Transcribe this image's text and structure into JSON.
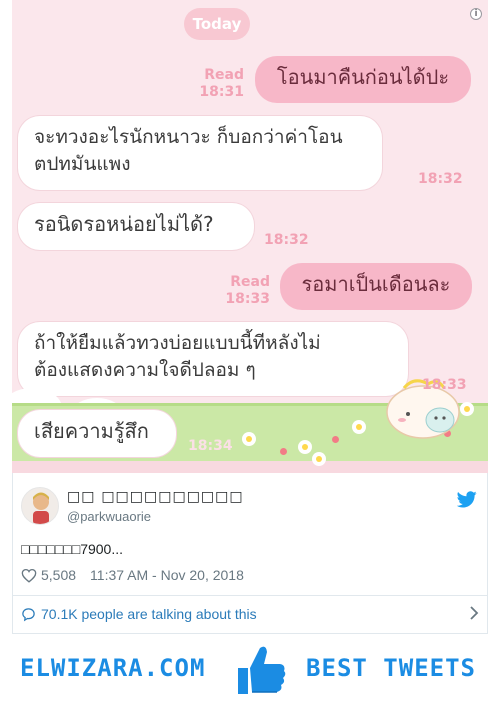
{
  "colors": {
    "chat_bg": "#fbe7ec",
    "outgoing_bubble": "#f7b7c8",
    "incoming_bubble": "#ffffff",
    "meta_pink": "#f2a2b4",
    "twitter_blue": "#1da1f2",
    "link_blue": "#2b7bb9",
    "brand_blue": "#1b8ce3"
  },
  "chat": {
    "date_chip": "Today",
    "messages": [
      {
        "dir": "out",
        "text": "โอนมาคืนก่อนได้ปะ",
        "status": "Read",
        "time": "18:31"
      },
      {
        "dir": "in",
        "text_line1": "จะทวงอะไรนักหนาวะ ก็บอกว่าค่าโอน",
        "text_line2": "ตปทมันแพง",
        "time": "18:32"
      },
      {
        "dir": "in",
        "text": "รอนิดรอหน่อยไม่ได้?",
        "time": "18:32"
      },
      {
        "dir": "out",
        "text": "รอมาเป็นเดือนละ",
        "status": "Read",
        "time": "18:33"
      },
      {
        "dir": "in",
        "text_line1": "ถ้าให้ยืมแล้วทวงบ่อยแบบนี้ทีหลังไม่",
        "text_line2": "ต้องแสดงความใจดีปลอม ๆ",
        "time": "18:33"
      },
      {
        "dir": "in",
        "text": "เสียความรู้สึก",
        "time": "18:34"
      }
    ]
  },
  "tweet": {
    "author_name": "□□ □□□□□□□□□□",
    "handle": "@parkwuaorie",
    "text": "□□□□□□□7900...",
    "likes": "5,508",
    "timestamp": "11:37 AM - Nov 20, 2018",
    "talking": "70.1K people are talking about this",
    "icons": {
      "brand": "twitter-bird-icon",
      "like": "heart-icon",
      "reply": "speech-bubble-icon",
      "more": "chevron-right-icon"
    }
  },
  "banner": {
    "left_text": "ELWIZARA.COM",
    "right_text": "BEST TWEETS",
    "icon": "thumbs-up-icon"
  }
}
